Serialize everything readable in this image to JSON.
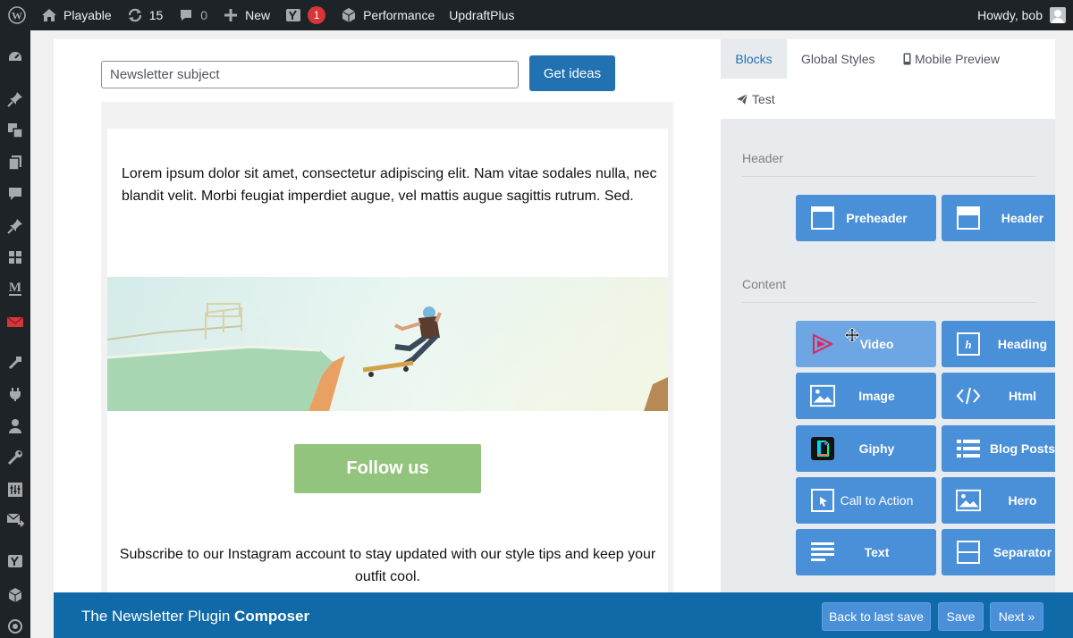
{
  "adminbar": {
    "site_name": "Playable",
    "updates_count": "15",
    "comments_count": "0",
    "new_label": "New",
    "yoast_badge": "1",
    "performance_label": "Performance",
    "updraft_label": "UpdraftPlus",
    "greeting": "Howdy, bob"
  },
  "composer": {
    "subject_placeholder": "Newsletter subject",
    "get_ideas_label": "Get ideas",
    "email": {
      "body_text": "Lorem ipsum dolor sit amet, consectetur adipiscing elit. Nam vitae sodales nulla, nec blandit velit. Morbi feugiat imperdiet augue, vel mattis augue sagittis rutrum. Sed.",
      "follow_label": "Follow us",
      "subscribe_text": "Subscribe to our Instagram account to stay updated with our style tips and keep your outfit cool."
    }
  },
  "panel": {
    "tabs": [
      {
        "label": "Blocks",
        "active": true
      },
      {
        "label": "Global Styles",
        "active": false
      },
      {
        "label": "Mobile Preview",
        "active": false
      },
      {
        "label": "Test",
        "active": false
      }
    ],
    "sections": {
      "header_label": "Header",
      "content_label": "Content"
    },
    "header_blocks": [
      {
        "label": "Preheader",
        "icon": "preheader-icon"
      },
      {
        "label": "Header",
        "icon": "header-icon"
      }
    ],
    "content_blocks": [
      {
        "label": "Video",
        "icon": "video-icon"
      },
      {
        "label": "Heading",
        "icon": "heading-icon"
      },
      {
        "label": "Image",
        "icon": "image-icon"
      },
      {
        "label": "Html",
        "icon": "code-icon"
      },
      {
        "label": "Giphy",
        "icon": "giphy-icon"
      },
      {
        "label": "Blog Posts",
        "icon": "list-icon"
      },
      {
        "label": "Call to Action",
        "icon": "cta-icon"
      },
      {
        "label": "Hero",
        "icon": "hero-icon"
      },
      {
        "label": "Text",
        "icon": "text-icon"
      },
      {
        "label": "Separator",
        "icon": "separator-icon"
      }
    ]
  },
  "footer": {
    "title_prefix": "The Newsletter Plugin",
    "title_bold": "Composer",
    "back_label": "Back to last save",
    "save_label": "Save",
    "next_label": "Next »"
  },
  "colors": {
    "primary": "#2271b1",
    "block_blue": "#4a90d9",
    "footer_blue": "#106aa8",
    "follow_green": "#93c47d"
  }
}
